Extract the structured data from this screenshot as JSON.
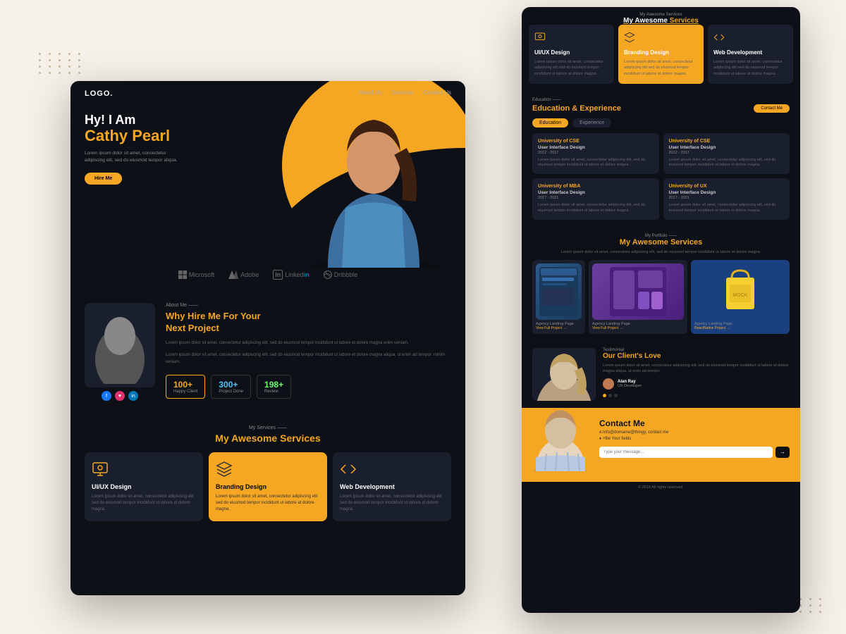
{
  "page": {
    "background": "#f5f0e8"
  },
  "navbar": {
    "logo": "LOGO.",
    "links": [
      {
        "label": "Home",
        "active": true
      },
      {
        "label": "About Us",
        "active": false
      },
      {
        "label": "Services",
        "active": false
      },
      {
        "label": "Contact Us",
        "active": false
      }
    ]
  },
  "hero": {
    "greeting": "Hy! I Am",
    "name": "Cathy Pearl",
    "description": "Lorem ipsum dolor sit amet, consectetur adipiscing elit, sed do eiusmod tempor aliqua.",
    "cta_button": "Hire Me"
  },
  "brands": [
    {
      "name": "Microsoft",
      "icon": "⊞"
    },
    {
      "name": "Adobe",
      "icon": "A"
    },
    {
      "name": "LinkedIn",
      "icon": "in"
    },
    {
      "name": "Dribbble",
      "icon": "⊕"
    }
  ],
  "about": {
    "label": "About Me ——",
    "title_line1": "Why Hire Me For Your",
    "title_line2_plain": "",
    "title_line2_yellow": "Next Project",
    "description1": "Lorem ipsum dolor sit amet, consectetur adipiscing elit, sed do eiusmod tempor incididunt ut labore et dolore magna enim veniam.",
    "description2": "Lorem ipsum dolor sit amet, consectetur adipiscing elit, sed do eiusmod tempor incididunt ut labore et dolore magna aliqua, ut enim ad tempor. minim veniam.",
    "stats": [
      {
        "number": "100+",
        "label": "Happy Client"
      },
      {
        "number": "300+",
        "label": "Project Done"
      },
      {
        "number": "198+",
        "label": "Review"
      }
    ]
  },
  "services": {
    "label": "My Services ——",
    "title_plain": "My Awesome",
    "title_yellow": "Services",
    "cards": [
      {
        "name": "UI/UX Design",
        "description": "Lorem ipsum dolor sit amet, consectetur adipiscing elit sed do eiusmod tempor incididunt ut labore at dolore magna.",
        "active": false
      },
      {
        "name": "Branding Design",
        "description": "Lorem ipsum dolor sit amet, consectetur adipiscing elit sed do eiusmod tempor incididunt ut labore at dolore magna.",
        "active": true
      },
      {
        "name": "Web Development",
        "description": "Lorem ipsum dolor sit amet, consectetur adipiscing elit sed do eiusmod tempor incididunt ut labore at dolore magna.",
        "active": false
      }
    ]
  },
  "education": {
    "label": "Education ——",
    "title_plain": "Education &",
    "title_yellow": "Experience",
    "tabs": [
      {
        "label": "Education",
        "active": true
      },
      {
        "label": "Experience",
        "active": false
      }
    ],
    "button": "Contact Me",
    "cards": [
      {
        "university": "University of CSE",
        "degree": "User Interface Design",
        "date": "2012 - 2017",
        "description": "Lorem ipsum dolor sit amet, consectetur adipiscing elit, sed do eiusmod tempor incididunt ut labore et dolore magna."
      },
      {
        "university": "University of CSE",
        "degree": "User Interface Design",
        "date": "2012 - 2017",
        "description": "Lorem ipsum dolor sit amet, consectetur adipiscing elit, sed do eiusmod tempor incididunt ut labore et dolore magna."
      },
      {
        "university": "University of MBA",
        "degree": "User Interface Design",
        "date": "2017 - 2021",
        "description": "Lorem ipsum dolor sit amet, consectetur adipiscing elit, sed do eiusmod tempor incididunt ut labore et dolore magna."
      },
      {
        "university": "University of UX",
        "degree": "User Interface Design",
        "date": "2017 - 2021",
        "description": "Lorem ipsum dolor sit amet, consectetur adipiscing elit, sed do eiusmod tempor incididunt ut labore et dolore magna."
      }
    ]
  },
  "portfolio": {
    "label": "My Portfolio ——",
    "title_plain": "My Awesome",
    "title_yellow": "Services",
    "description": "Lorem ipsum dolor sit amet, consectetur adipiscing elit, sed do eiusmod tempor incididunt ut labore et dolore magna.",
    "items": [
      {
        "label": "Agency Landing Page",
        "link": "View Full Project →",
        "tag": ""
      },
      {
        "label": "Agency Landing Page",
        "link": "View Full Project →",
        "tag": ""
      },
      {
        "label": "Agency Landing Page",
        "link": "ReactNative Project →",
        "tag": ""
      }
    ]
  },
  "testimonial": {
    "label": "Testimonial",
    "title_plain": "Our Client's",
    "title_yellow": "Love",
    "text": "Lorem ipsum dolor sit amet, consectetur adipiscing elit, sed do eiusmod tempor incididunt ut labore et dolore magna aliqua, ut enim ad tempor.",
    "author_name": "Alan Ray",
    "author_role": "UX Developer",
    "dots": [
      true,
      false,
      false
    ]
  },
  "contact": {
    "title": "Contact Me",
    "email": "e.Info@domaine@thingy, contact me",
    "phone": "♦ +file Your fields",
    "input_placeholder": "Type your message...",
    "send_button": "→",
    "footer": "© 2018 All rights reserved."
  }
}
